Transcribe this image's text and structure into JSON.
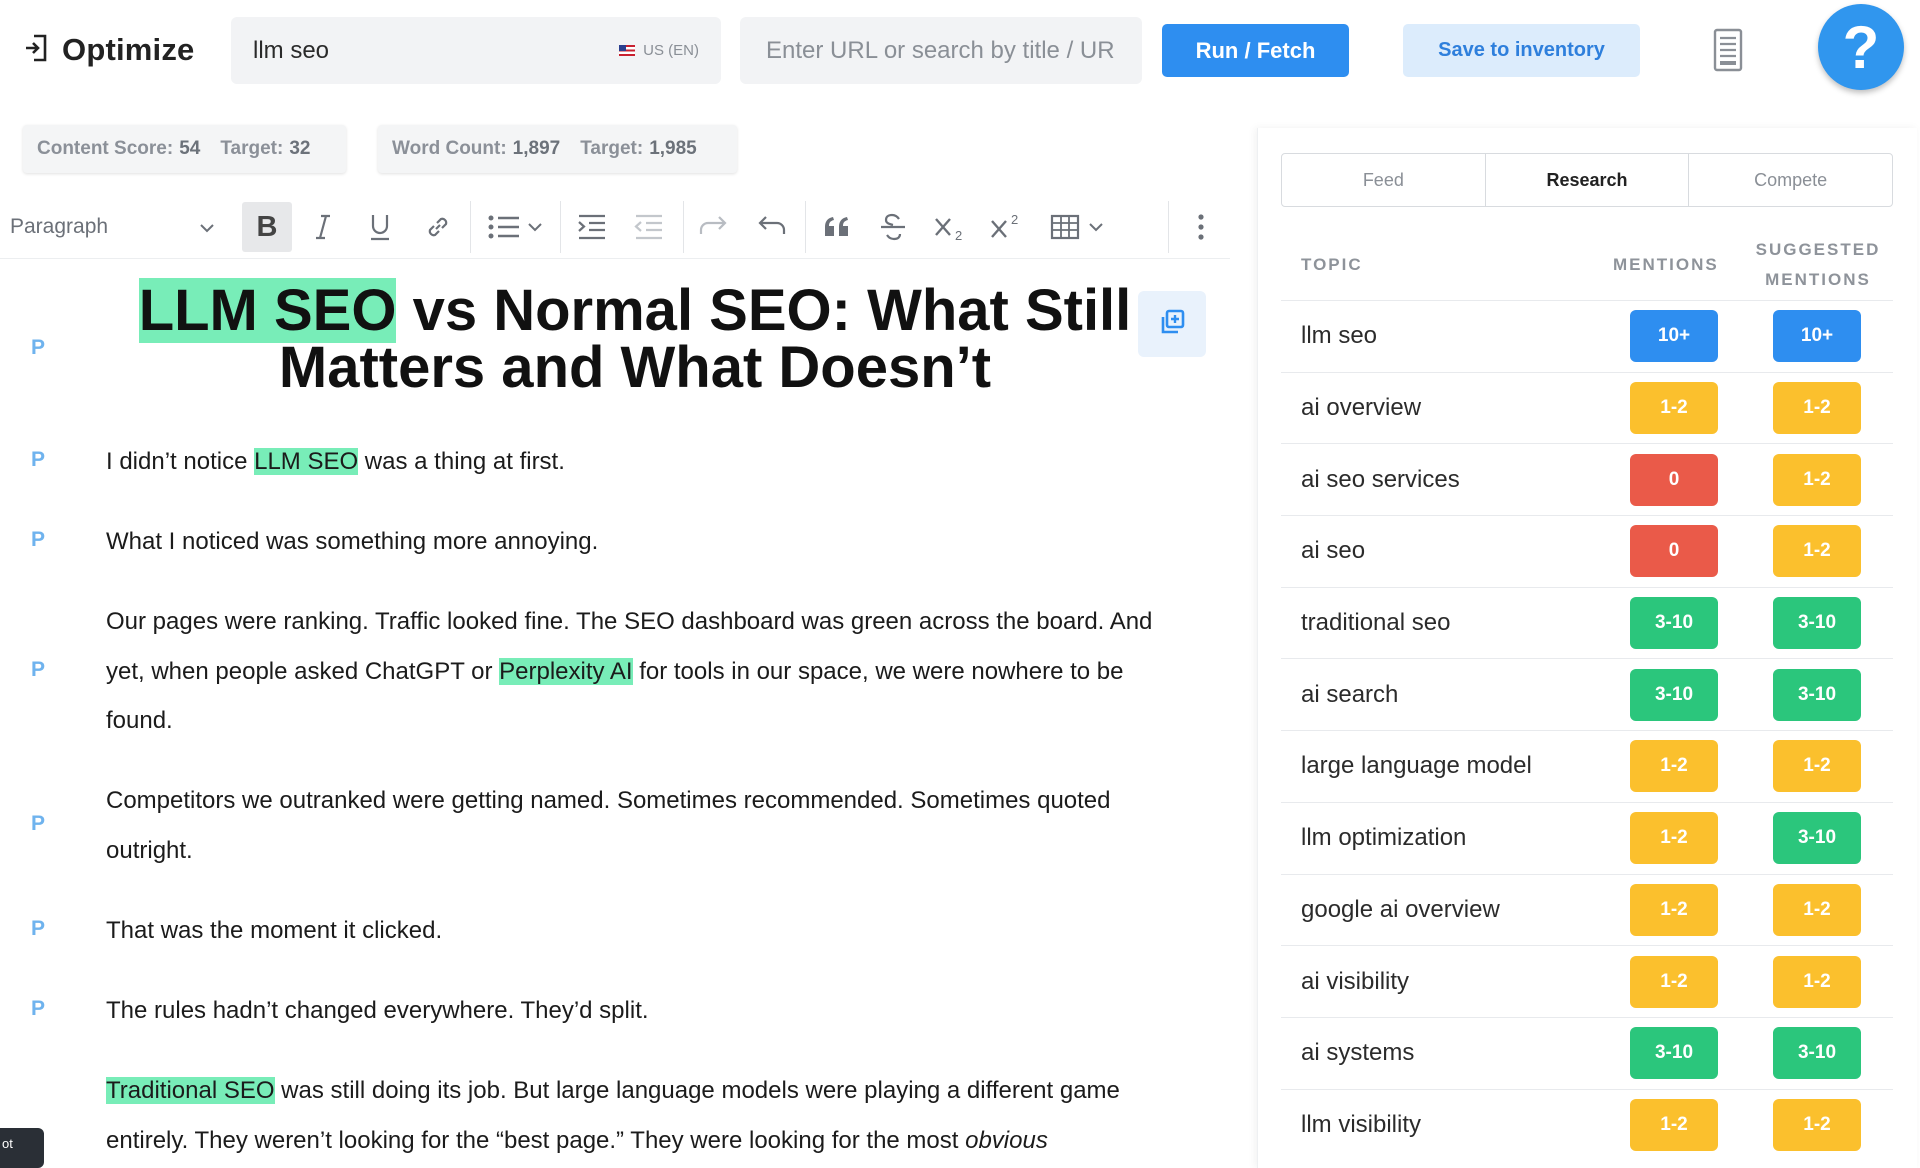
{
  "brand": {
    "name": "Optimize",
    "icon": "logout-icon"
  },
  "keyword": {
    "value": "llm seo",
    "locale": "US (EN)"
  },
  "url_search": {
    "placeholder": "Enter URL or search by title / URL"
  },
  "actions": {
    "run_label": "Run / Fetch",
    "save_label": "Save to inventory",
    "help_label": "?"
  },
  "scores": {
    "content_label": "Content Score:",
    "content_value": "54",
    "content_target_label": "Target:",
    "content_target": "32",
    "words_label": "Word Count:",
    "words_value": "1,897",
    "words_target_label": "Target:",
    "words_target": "1,985"
  },
  "toolbar": {
    "block_type": "Paragraph",
    "bold": "B"
  },
  "editor": {
    "block_marker": "P",
    "title_highlight": "LLM SEO",
    "title_rest": " vs Normal SEO: What Still Matters and What Doesn’t",
    "paragraphs": [
      {
        "before": "I didn’t notice ",
        "hl": "LLM SEO",
        "after": " was a thing at first."
      },
      {
        "before": "What I noticed was something more annoying.",
        "hl": "",
        "after": ""
      },
      {
        "before": "Our pages were ranking. Traffic looked fine. The SEO dashboard was green across the board. And yet, when people asked ChatGPT or ",
        "hl": "Perplexity AI",
        "after": " for tools in our space, we were nowhere to be found."
      },
      {
        "before": "Competitors we outranked were getting named. Sometimes recommended. Sometimes quoted outright.",
        "hl": "",
        "after": ""
      },
      {
        "before": "That was the moment it clicked.",
        "hl": "",
        "after": ""
      },
      {
        "before": "The rules hadn’t changed everywhere. They’d split.",
        "hl": "",
        "after": ""
      },
      {
        "before": "",
        "hl": "Traditional SEO",
        "after": " was still doing its job. But large language models were playing a different game entirely. They weren’t looking for the “best page.” They were looking for the most ",
        "italic": "obvious"
      }
    ]
  },
  "panel": {
    "tabs": [
      "Feed",
      "Research",
      "Compete"
    ],
    "active_tab": "Research",
    "headers": {
      "topic": "TOPIC",
      "mentions": "MENTIONS",
      "suggested_1": "SUGGESTED",
      "suggested_2": "MENTIONS"
    },
    "rows": [
      {
        "topic": "llm seo",
        "mentions": "10+",
        "m_color": "#2e8ef0",
        "suggested": "10+",
        "s_color": "#2e8ef0"
      },
      {
        "topic": "ai overview",
        "mentions": "1-2",
        "m_color": "#fbc02d",
        "suggested": "1-2",
        "s_color": "#fbc02d"
      },
      {
        "topic": "ai seo services",
        "mentions": "0",
        "m_color": "#ea5a49",
        "suggested": "1-2",
        "s_color": "#fbc02d"
      },
      {
        "topic": "ai seo",
        "mentions": "0",
        "m_color": "#ea5a49",
        "suggested": "1-2",
        "s_color": "#fbc02d"
      },
      {
        "topic": "traditional seo",
        "mentions": "3-10",
        "m_color": "#2bc67c",
        "suggested": "3-10",
        "s_color": "#2bc67c"
      },
      {
        "topic": "ai search",
        "mentions": "3-10",
        "m_color": "#2bc67c",
        "suggested": "3-10",
        "s_color": "#2bc67c"
      },
      {
        "topic": "large language model",
        "mentions": "1-2",
        "m_color": "#fbc02d",
        "suggested": "1-2",
        "s_color": "#fbc02d"
      },
      {
        "topic": "llm optimization",
        "mentions": "1-2",
        "m_color": "#fbc02d",
        "suggested": "3-10",
        "s_color": "#2bc67c"
      },
      {
        "topic": "google ai overview",
        "mentions": "1-2",
        "m_color": "#fbc02d",
        "suggested": "1-2",
        "s_color": "#fbc02d"
      },
      {
        "topic": "ai visibility",
        "mentions": "1-2",
        "m_color": "#fbc02d",
        "suggested": "1-2",
        "s_color": "#fbc02d"
      },
      {
        "topic": "ai systems",
        "mentions": "3-10",
        "m_color": "#2bc67c",
        "suggested": "3-10",
        "s_color": "#2bc67c"
      },
      {
        "topic": "llm visibility",
        "mentions": "1-2",
        "m_color": "#fbc02d",
        "suggested": "1-2",
        "s_color": "#fbc02d"
      }
    ]
  }
}
